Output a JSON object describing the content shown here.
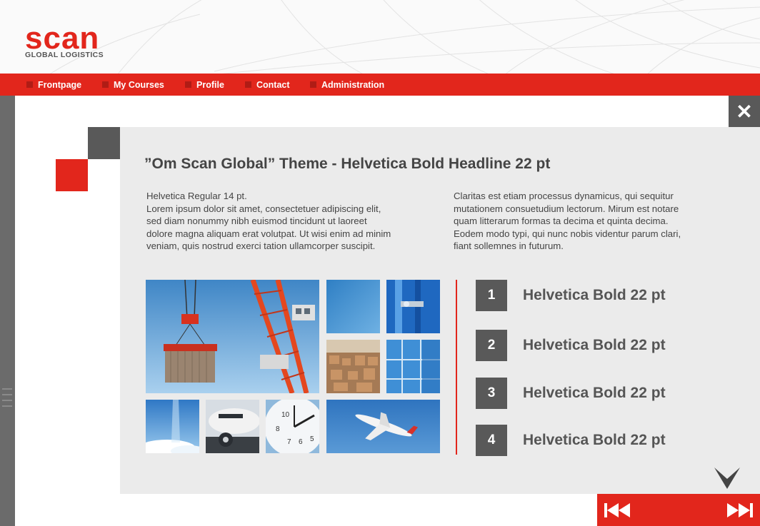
{
  "logo": {
    "main": "scan",
    "sub": "GLOBAL LOGISTICS"
  },
  "nav": {
    "items": [
      {
        "label": "Frontpage"
      },
      {
        "label": "My Courses"
      },
      {
        "label": "Profile"
      },
      {
        "label": "Contact"
      },
      {
        "label": "Administration"
      }
    ]
  },
  "close": {
    "label": "✕",
    "icon": "close-icon"
  },
  "content": {
    "headline": "”Om Scan Global” Theme - Helvetica Bold Headline 22 pt",
    "left_column": [
      "Helvetica Regular 14 pt.",
      "Lorem ipsum dolor sit amet, consectetuer adipiscing elit,",
      "sed diam nonummy nibh euismod tincidunt ut laoreet",
      "dolore magna aliquam erat volutpat. Ut wisi enim ad minim",
      "veniam, quis nostrud exerci tation ullamcorper suscipit."
    ],
    "right_column": [
      "Claritas est etiam processus dynamicus, qui sequitur",
      "mutationem consuetudium lectorum. Mirum est notare",
      "quam  litterarum formas ta decima et quinta decima.",
      "Eodem modo typi, qui nunc nobis videntur parum clari,",
      "fiant sollemnes in futurum."
    ],
    "numbered_items": [
      {
        "number": "1",
        "label": "Helvetica Bold 22 pt"
      },
      {
        "number": "2",
        "label": "Helvetica Bold 22 pt"
      },
      {
        "number": "3",
        "label": "Helvetica Bold 22 pt"
      },
      {
        "number": "4",
        "label": "Helvetica Bold 22 pt"
      }
    ]
  },
  "images": [
    "crane-container-photo",
    "blue-sky-photo",
    "container-door-photo",
    "warehouse-photo",
    "glass-building-photo",
    "clouds-sun-photo",
    "airplane-nose-photo",
    "clock-photo",
    "airplane-takeoff-photo"
  ],
  "controls": {
    "previous_icon": "skip-back-icon",
    "next_icon": "skip-forward-icon",
    "scroll_icon": "chevron-down-icon"
  },
  "colors": {
    "brand_red": "#e2261c",
    "dark_gray": "#595959",
    "panel_gray": "#ebebeb",
    "text_gray": "#444444"
  }
}
